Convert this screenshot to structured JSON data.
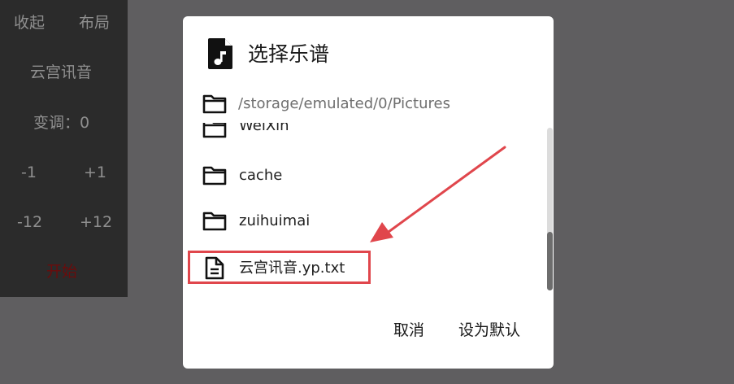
{
  "panel": {
    "collapse": "收起",
    "layout": "布局",
    "song": "云宫讯音",
    "transpose": "变调：0",
    "minus1": "-1",
    "plus1": "+1",
    "minus12": "-12",
    "plus12": "+12",
    "start": "开始"
  },
  "dialog": {
    "title": "选择乐谱",
    "path": "/storage/emulated/0/Pictures",
    "items": [
      {
        "name": "WeiXin",
        "type": "folder"
      },
      {
        "name": "cache",
        "type": "folder"
      },
      {
        "name": "zuihuimai",
        "type": "folder"
      },
      {
        "name": "云宫讯音.yp.txt",
        "type": "file"
      }
    ],
    "cancel": "取消",
    "set_default": "设为默认"
  },
  "colors": {
    "highlight": "#e0464c",
    "start_text": "#6a0c0c"
  }
}
